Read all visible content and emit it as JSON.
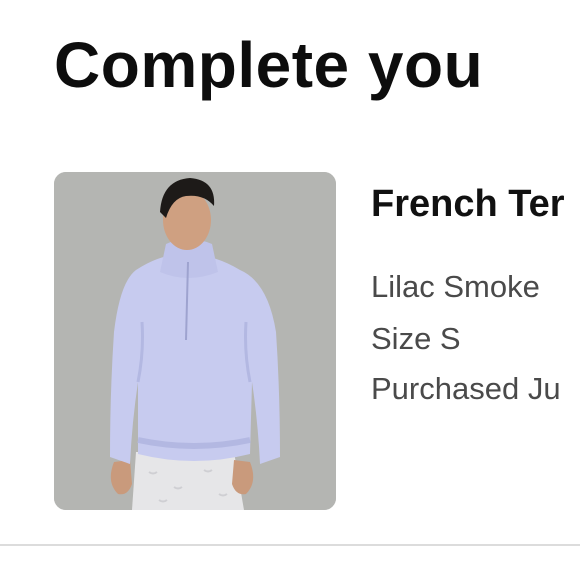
{
  "page": {
    "heading": "Complete you"
  },
  "product": {
    "name": "French Ter",
    "color": "Lilac Smoke",
    "size": "Size S",
    "purchased": "Purchased Ju",
    "image_background": "#b5b6b3",
    "garment_color": "#c7cbef"
  }
}
